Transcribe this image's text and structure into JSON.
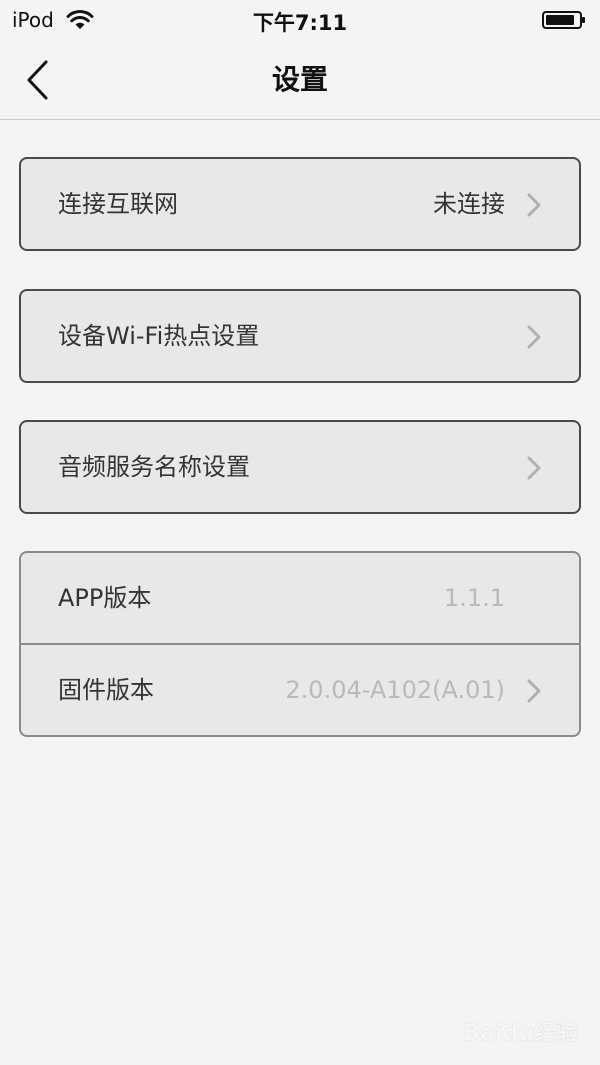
{
  "status_bar": {
    "device": "iPod",
    "time": "下午7:11"
  },
  "nav": {
    "title": "设置"
  },
  "settings": {
    "internet": {
      "label": "连接互联网",
      "value": "未连接"
    },
    "hotspot": {
      "label": "设备Wi-Fi热点设置"
    },
    "audio_service": {
      "label": "音频服务名称设置"
    },
    "app_version": {
      "label": "APP版本",
      "value": "1.1.1"
    },
    "firmware_version": {
      "label": "固件版本",
      "value": "2.0.04-A102(A.01)"
    }
  },
  "watermark": {
    "text": "Baidu经验"
  },
  "colors": {
    "background": "#f4f4f4",
    "card": "#e8e8e8",
    "border": "#4a4a4a",
    "muted_text": "#b9b9b9"
  }
}
